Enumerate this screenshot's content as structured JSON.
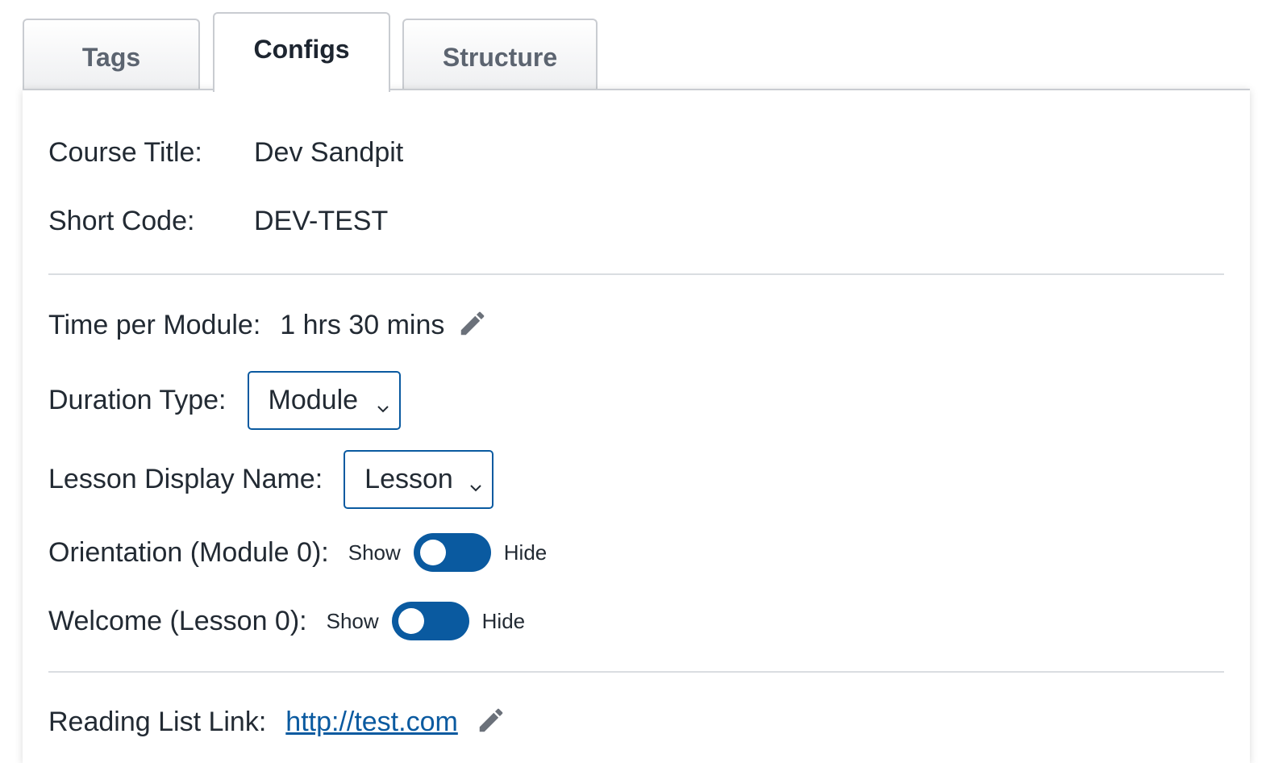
{
  "tabs": [
    {
      "label": "Tags",
      "active": false
    },
    {
      "label": "Configs",
      "active": true
    },
    {
      "label": "Structure",
      "active": false
    }
  ],
  "course": {
    "title_label": "Course Title:",
    "title_value": "Dev Sandpit",
    "code_label": "Short Code:",
    "code_value": "DEV-TEST"
  },
  "settings": {
    "time_label": "Time per Module:",
    "time_value": "1 hrs 30 mins",
    "time_edit_icon": "pencil-icon",
    "duration_label": "Duration Type:",
    "duration_selected": "Module",
    "lesson_name_label": "Lesson Display Name:",
    "lesson_name_selected": "Lesson",
    "orientation_label": "Orientation (Module 0):",
    "orientation_show": "Show",
    "orientation_hide": "Hide",
    "welcome_label": "Welcome (Lesson 0):",
    "welcome_show": "Show",
    "welcome_hide": "Hide"
  },
  "reading": {
    "label": "Reading List Link:",
    "link": "http://test.com",
    "edit_icon": "pencil-icon"
  },
  "colors": {
    "accent": "#0a5aa0",
    "text": "#222a33",
    "tab_inactive_text": "#5c6470",
    "icon": "#6b717a",
    "divider": "#dadde1"
  }
}
